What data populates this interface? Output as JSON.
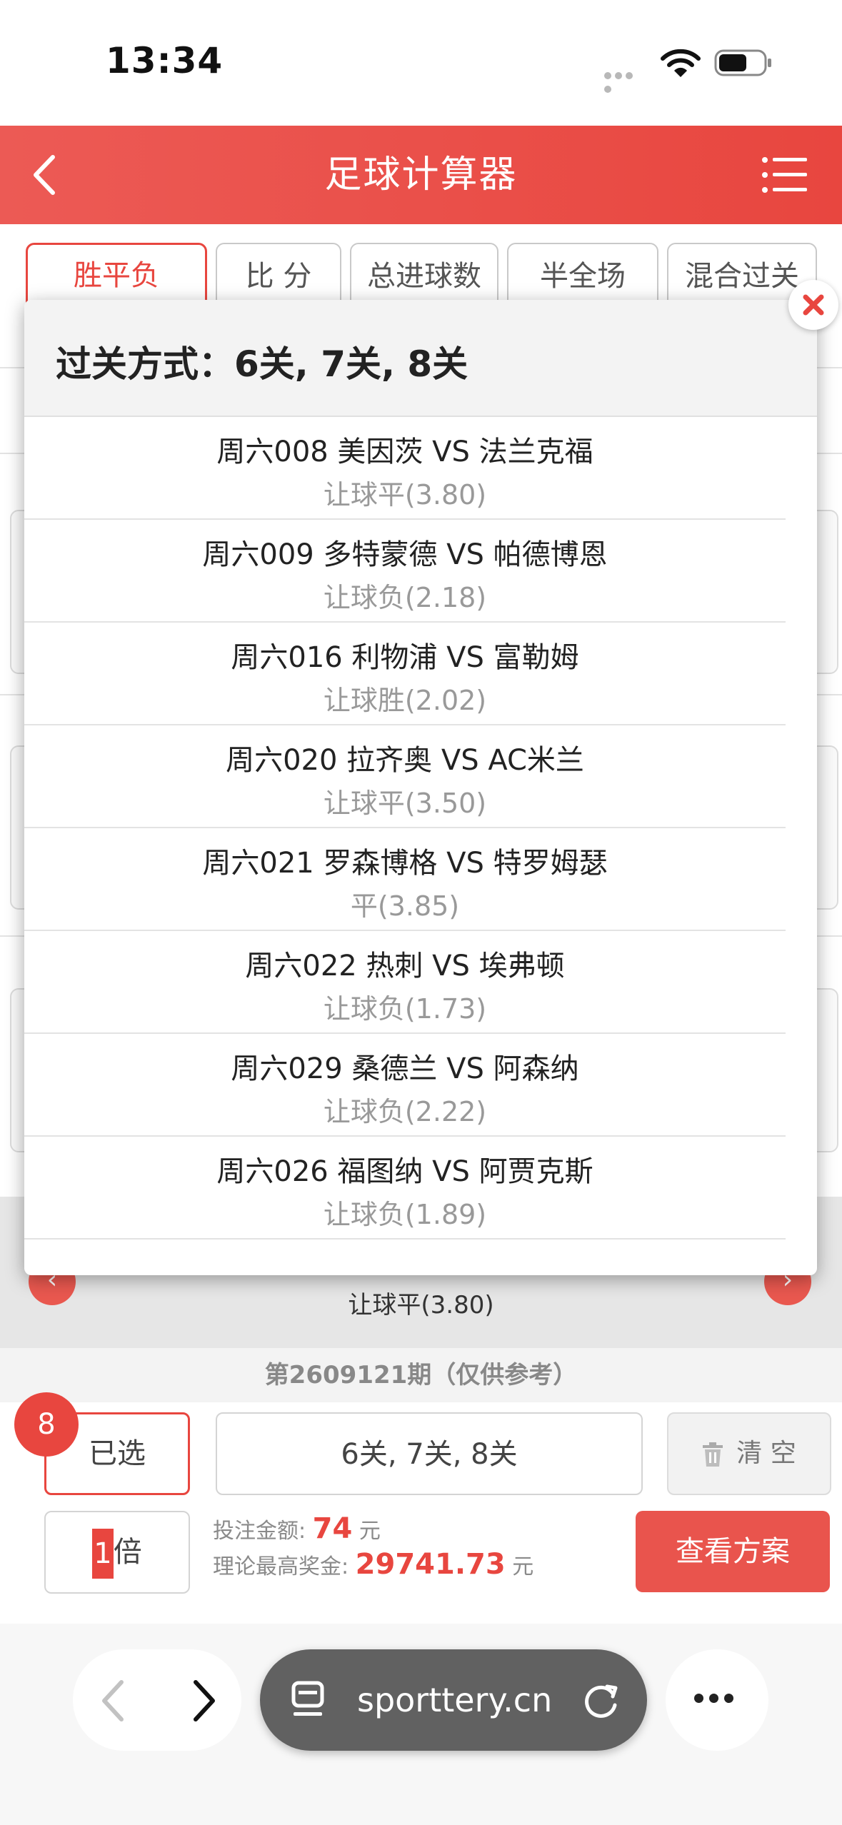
{
  "status": {
    "time": "13:34"
  },
  "header": {
    "title": "足球计算器"
  },
  "tabs": [
    {
      "label": "胜平负",
      "active": true
    },
    {
      "label": "比 分",
      "active": false
    },
    {
      "label": "总进球数",
      "active": false
    },
    {
      "label": "半全场",
      "active": false
    },
    {
      "label": "混合过关",
      "active": false
    }
  ],
  "popup": {
    "title": "过关方式：6关, 7关, 8关",
    "matches": [
      {
        "name": "周六008 美因茨 VS 法兰克福",
        "pick": "让球平(3.80)"
      },
      {
        "name": "周六009 多特蒙德 VS 帕德博恩",
        "pick": "让球负(2.18)"
      },
      {
        "name": "周六016 利物浦 VS 富勒姆",
        "pick": "让球胜(2.02)"
      },
      {
        "name": "周六020 拉齐奥 VS AC米兰",
        "pick": "让球平(3.50)"
      },
      {
        "name": "周六021 罗森博格 VS 特罗姆瑟",
        "pick": "平(3.85)"
      },
      {
        "name": "周六022 热刺 VS 埃弗顿",
        "pick": "让球负(1.73)"
      },
      {
        "name": "周六029 桑德兰 VS 阿森纳",
        "pick": "让球负(2.22)"
      },
      {
        "name": "周六026 福图纳 VS 阿贾克斯",
        "pick": "让球负(1.89)"
      }
    ]
  },
  "behind": {
    "strip_text": "让球平(3.80)"
  },
  "period": {
    "text": "第2609121期（仅供参考）"
  },
  "bet": {
    "selected_count": "8",
    "selected_label": "已选",
    "pass_types": "6关, 7关, 8关",
    "clear_label": "清 空",
    "multiplier_value": "1",
    "multiplier_unit": "倍",
    "stake_label": "投注金额:",
    "stake_value": "74",
    "stake_unit": "元",
    "max_prize_label": "理论最高奖金:",
    "max_prize_value": "29741.73",
    "max_prize_unit": "元",
    "view_plan_label": "查看方案"
  },
  "browser": {
    "url": "sporttery.cn"
  },
  "colors": {
    "accent": "#e8463f",
    "header_bg": "#ec5a55"
  }
}
